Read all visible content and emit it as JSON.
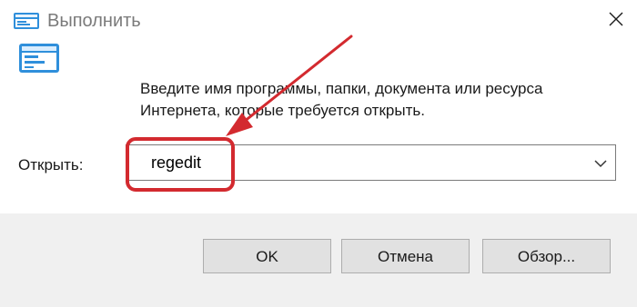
{
  "window": {
    "title": "Выполнить",
    "close_icon": "close-icon"
  },
  "content": {
    "description": "Введите имя программы, папки, документа или ресурса Интернета, которые требуется открыть.",
    "open_label": "Открыть:",
    "open_value": "regedit"
  },
  "buttons": {
    "ok": "OK",
    "cancel": "Отмена",
    "browse": "Обзор..."
  },
  "annotation": {
    "color": "#d32a2f"
  }
}
